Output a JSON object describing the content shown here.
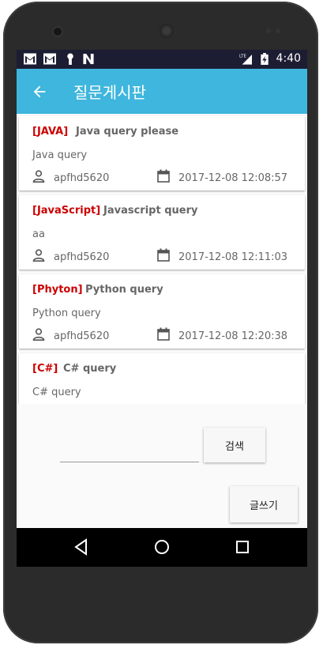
{
  "status_bar": {
    "time": "4:40",
    "icons": [
      "gmail-icon",
      "gmail-icon",
      "key-icon",
      "n-icon",
      "lte-signal-icon",
      "battery-charging-icon"
    ]
  },
  "app_bar": {
    "title": "질문게시판",
    "back_icon": "arrow-left-icon"
  },
  "posts": [
    {
      "tag": "[JAVA]",
      "title": "Java query please",
      "body": "Java query",
      "user": "apfhd5620",
      "date": "2017-12-08 12:08:57"
    },
    {
      "tag": "[JavaScript]",
      "title": "Javascript query",
      "body": "aa",
      "user": "apfhd5620",
      "date": "2017-12-08 12:11:03"
    },
    {
      "tag": "[Phyton]",
      "title": "Python query",
      "body": "Python query",
      "user": "apfhd5620",
      "date": "2017-12-08 12:20:38"
    },
    {
      "tag": "[C#]",
      "title": "C# query",
      "body": "C# query",
      "user": "",
      "date": ""
    }
  ],
  "search": {
    "value": "",
    "button_label": "검색"
  },
  "write_button_label": "글쓰기",
  "colors": {
    "app_bar": "#3fb6dd",
    "status_bar": "#1c1c33",
    "tag": "#cc0000"
  }
}
